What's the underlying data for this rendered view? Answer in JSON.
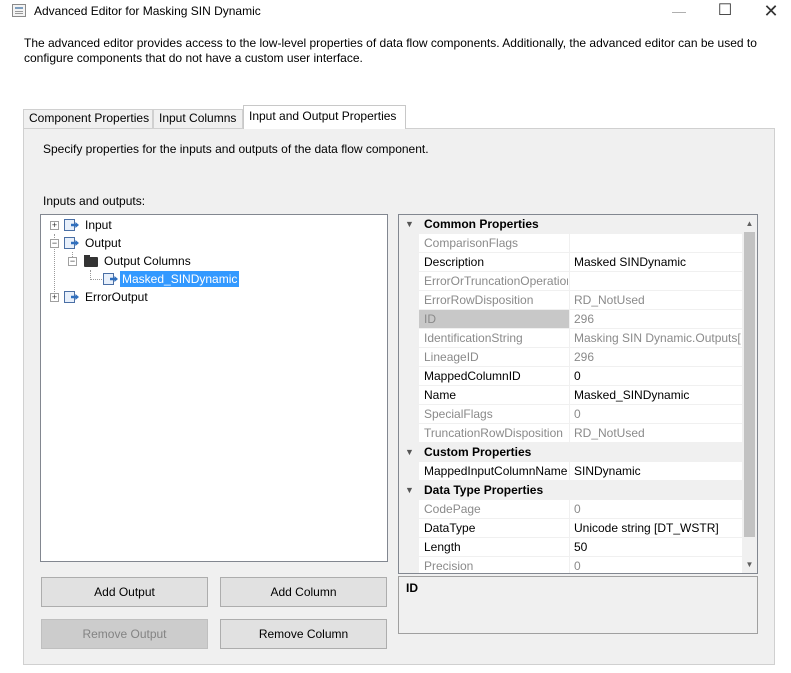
{
  "window": {
    "title": "Advanced Editor for Masking SIN Dynamic",
    "minimize_glyph": "—",
    "maximize_glyph": "☐",
    "close_glyph": "✕"
  },
  "description": "The advanced editor provides access to the low-level properties of data flow components. Additionally, the advanced editor can be used to configure components that do not have a custom user interface.",
  "tabs": [
    {
      "label": "Component Properties"
    },
    {
      "label": "Input Columns"
    },
    {
      "label": "Input and Output Properties",
      "active": true
    }
  ],
  "panel": {
    "description": "Specify properties for the inputs and outputs of the data flow component.",
    "tree_label": "Inputs and outputs:"
  },
  "tree": {
    "input": {
      "label": "Input",
      "expander": "+"
    },
    "output": {
      "label": "Output",
      "expander": "−"
    },
    "output_columns": {
      "label": "Output Columns",
      "expander": "−"
    },
    "masked_column": {
      "label": "Masked_SINDynamic",
      "selected": true
    },
    "error_output": {
      "label": "ErrorOutput",
      "expander": "+"
    }
  },
  "property_grid": {
    "common": {
      "title": "Common Properties",
      "rows": [
        {
          "name": "ComparisonFlags",
          "value": "",
          "readonly": true
        },
        {
          "name": "Description",
          "value": "Masked SINDynamic",
          "readonly": false
        },
        {
          "name": "ErrorOrTruncationOperation",
          "value": "",
          "readonly": true
        },
        {
          "name": "ErrorRowDisposition",
          "value": "RD_NotUsed",
          "readonly": true
        },
        {
          "name": "ID",
          "value": "296",
          "readonly": true,
          "selected": true
        },
        {
          "name": "IdentificationString",
          "value": "Masking SIN Dynamic.Outputs[",
          "readonly": true
        },
        {
          "name": "LineageID",
          "value": "296",
          "readonly": true
        },
        {
          "name": "MappedColumnID",
          "value": "0",
          "readonly": false
        },
        {
          "name": "Name",
          "value": "Masked_SINDynamic",
          "readonly": false
        },
        {
          "name": "SpecialFlags",
          "value": "0",
          "readonly": true
        },
        {
          "name": "TruncationRowDisposition",
          "value": "RD_NotUsed",
          "readonly": true
        }
      ]
    },
    "custom": {
      "title": "Custom Properties",
      "rows": [
        {
          "name": "MappedInputColumnName",
          "value": "SINDynamic",
          "readonly": false
        }
      ]
    },
    "datatype": {
      "title": "Data Type Properties",
      "rows": [
        {
          "name": "CodePage",
          "value": "0",
          "readonly": true
        },
        {
          "name": "DataType",
          "value": "Unicode string [DT_WSTR]",
          "readonly": false
        },
        {
          "name": "Length",
          "value": "50",
          "readonly": false
        },
        {
          "name": "Precision",
          "value": "0",
          "readonly": true
        }
      ]
    },
    "scroll_up": "▲",
    "scroll_down": "▼",
    "collapse_glyph": "▼"
  },
  "property_description": {
    "title": "ID"
  },
  "buttons": {
    "add_output": "Add Output",
    "add_column": "Add Column",
    "remove_output": "Remove Output",
    "remove_column": "Remove Column"
  }
}
